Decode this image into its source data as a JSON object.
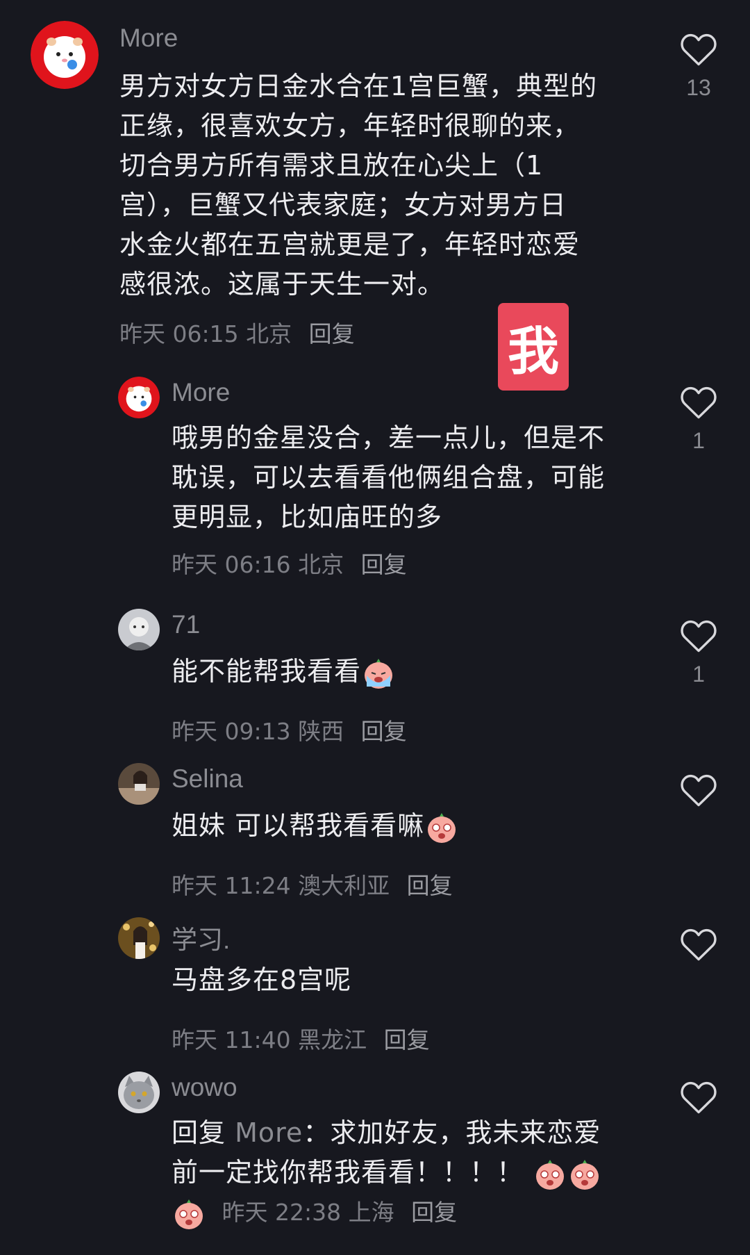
{
  "comments": [
    {
      "user": "More",
      "text_lines": [
        "男方对女方日金水合在1宫巨蟹，典型的",
        "正缘，很喜欢女方，年轻时很聊的来，",
        "切合男方所有需求且放在心尖上（1",
        "宫），巨蟹又代表家庭；女方对男方日",
        "水金火都在五宫就更是了，年轻时恋爱",
        "感很浓。这属于天生一对。"
      ],
      "time": "昨天 06:15",
      "location": "北京",
      "reply": "回复",
      "likes": "13"
    },
    {
      "user": "More",
      "text_lines": [
        "哦男的金星没合，差一点儿，但是不",
        "耽误，可以去看看他俩组合盘，可能",
        "更明显，比如庙旺的多"
      ],
      "time": "昨天 06:16",
      "location": "北京",
      "reply": "回复",
      "likes": "1"
    },
    {
      "user": "71",
      "text": "能不能帮我看看",
      "time": "昨天 09:13",
      "location": "陕西",
      "reply": "回复",
      "likes": "1"
    },
    {
      "user": "Selina",
      "text": "姐妹 可以帮我看看嘛",
      "time": "昨天 11:24",
      "location": "澳大利亚",
      "reply": "回复",
      "likes": ""
    },
    {
      "user": "学习.",
      "text": "马盘多在8宫呢",
      "time": "昨天 11:40",
      "location": "黑龙江",
      "reply": "回复",
      "likes": ""
    },
    {
      "user": "wowo",
      "reply_prefix": "回复",
      "reply_to": "More",
      "text_line1": "：求加好友，我未来恋爱",
      "text_line2": "前一定找你帮我看看！！！！",
      "time": "昨天 22:38",
      "location": "上海",
      "reply": "回复",
      "likes": ""
    }
  ],
  "badge": "我",
  "icons": {
    "like": "heart-outline-icon",
    "emoji_crying": "crying-face-emoji",
    "emoji_shocked": "shocked-face-emoji"
  },
  "colors": {
    "background": "#17181f",
    "badge": "#e9495b",
    "avatar_ring": "#e0141c"
  }
}
